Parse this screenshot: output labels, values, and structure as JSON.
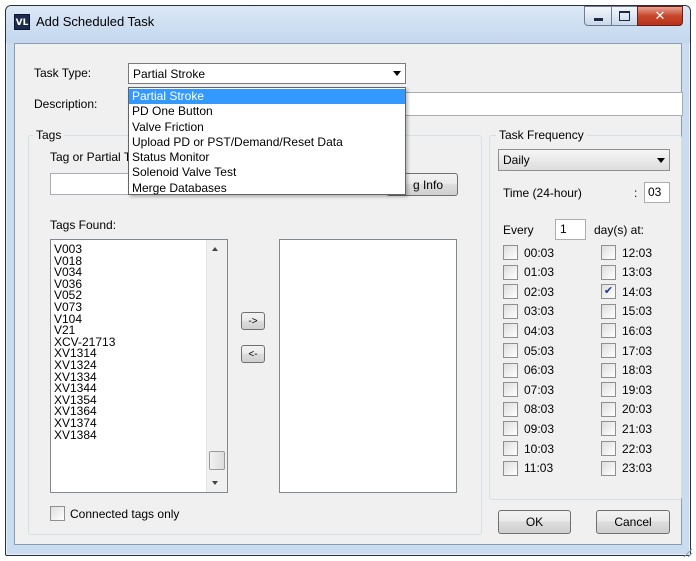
{
  "window": {
    "title": "Add Scheduled Task",
    "app_icon_text": "VL"
  },
  "task_type": {
    "label": "Task Type:",
    "selected": "Partial Stroke",
    "options": [
      "Partial Stroke",
      "PD One Button",
      "Valve Friction",
      "Upload PD or PST/Demand/Reset Data",
      "Status Monitor",
      "Solenoid Valve Test",
      "Merge Databases"
    ]
  },
  "description": {
    "label": "Description:",
    "value": ""
  },
  "tags": {
    "group_label": "Tags",
    "search_label": "Tag or Partial T",
    "search_value": "",
    "info_button": "g Info",
    "found_label": "Tags Found:",
    "found": [
      "V003",
      "V018",
      "V034",
      "V036",
      "V052",
      "V073",
      "V104",
      "V21",
      "XCV-21713",
      "XV1314",
      "XV1324",
      "XV1334",
      "XV1344",
      "XV1354",
      "XV1364",
      "XV1374",
      "XV1384"
    ],
    "selected": [],
    "add_button": "->",
    "remove_button": "<-",
    "connected_only_label": "Connected tags only",
    "connected_only_checked": false
  },
  "frequency": {
    "group_label": "Task Frequency",
    "selected": "Daily",
    "time_label": "Time (24-hour)",
    "time_separator": ":",
    "time_value": "03",
    "every_label": "Every",
    "every_value": "1",
    "days_label": "day(s) at:",
    "times_left": [
      {
        "label": "00:03",
        "checked": false
      },
      {
        "label": "01:03",
        "checked": false
      },
      {
        "label": "02:03",
        "checked": false
      },
      {
        "label": "03:03",
        "checked": false
      },
      {
        "label": "04:03",
        "checked": false
      },
      {
        "label": "05:03",
        "checked": false
      },
      {
        "label": "06:03",
        "checked": false
      },
      {
        "label": "07:03",
        "checked": false
      },
      {
        "label": "08:03",
        "checked": false
      },
      {
        "label": "09:03",
        "checked": false
      },
      {
        "label": "10:03",
        "checked": false
      },
      {
        "label": "11:03",
        "checked": false
      }
    ],
    "times_right": [
      {
        "label": "12:03",
        "checked": false
      },
      {
        "label": "13:03",
        "checked": false
      },
      {
        "label": "14:03",
        "checked": true
      },
      {
        "label": "15:03",
        "checked": false
      },
      {
        "label": "16:03",
        "checked": false
      },
      {
        "label": "17:03",
        "checked": false
      },
      {
        "label": "18:03",
        "checked": false
      },
      {
        "label": "19:03",
        "checked": false
      },
      {
        "label": "20:03",
        "checked": false
      },
      {
        "label": "21:03",
        "checked": false
      },
      {
        "label": "22:03",
        "checked": false
      },
      {
        "label": "23:03",
        "checked": false
      }
    ]
  },
  "buttons": {
    "ok": "OK",
    "cancel": "Cancel"
  },
  "icons": {
    "close": "close-icon",
    "minimize": "minimize-icon",
    "maximize": "maximize-icon",
    "dropdown": "chevron-down-icon",
    "check": "check-icon"
  }
}
